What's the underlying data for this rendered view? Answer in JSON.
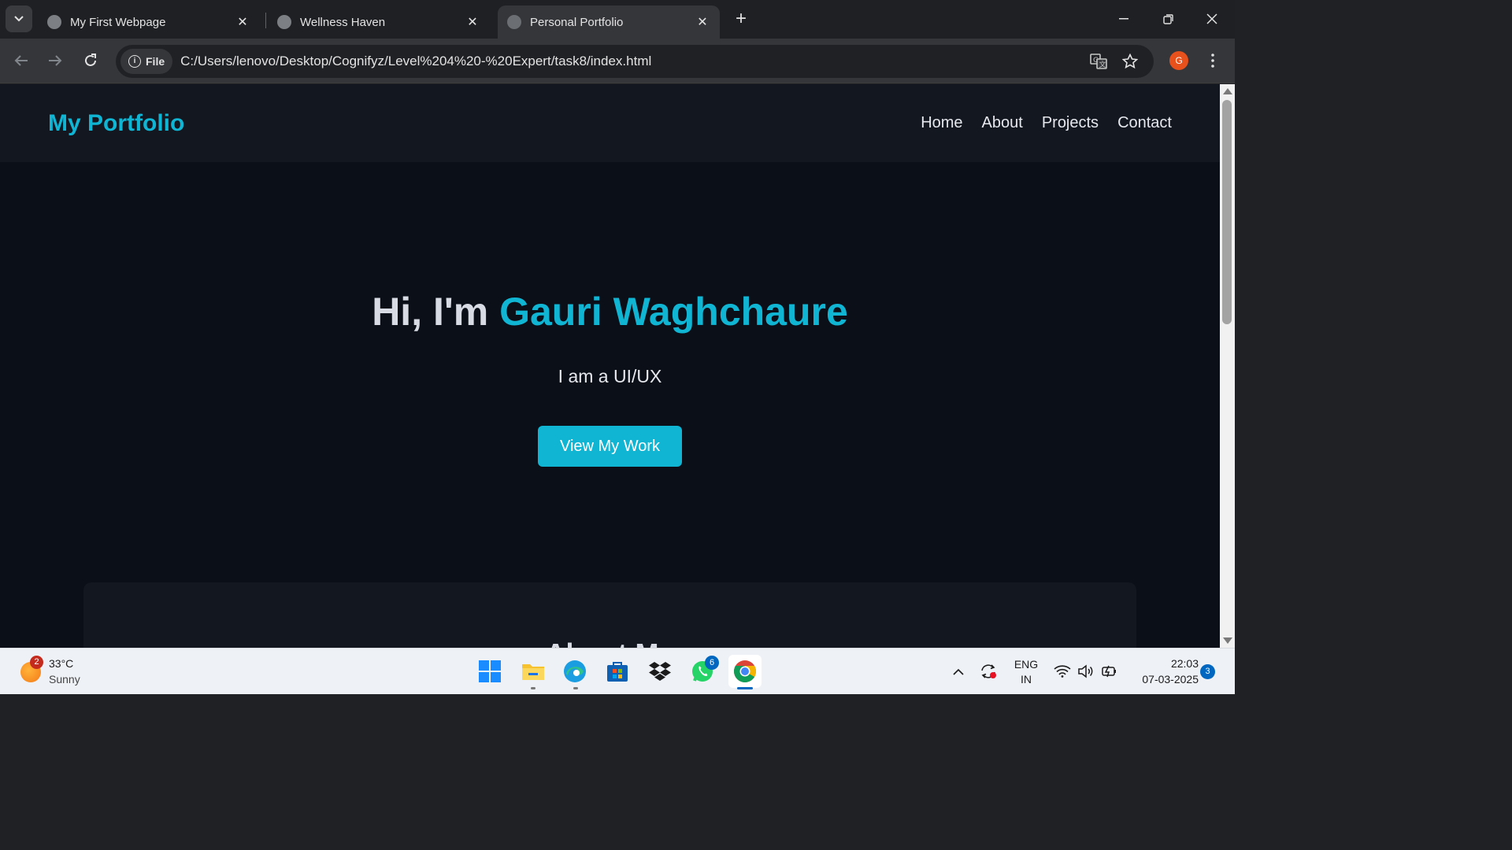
{
  "browser": {
    "tabs": [
      {
        "title": "My First Webpage",
        "active": false
      },
      {
        "title": "Wellness Haven",
        "active": false
      },
      {
        "title": "Personal Portfolio",
        "active": true
      }
    ],
    "chip_label": "File",
    "url": "C:/Users/lenovo/Desktop/Cognifyz/Level%204%20-%20Expert/task8/index.html",
    "profile_initial": "G"
  },
  "site": {
    "brand": "My Portfolio",
    "nav": [
      "Home",
      "About",
      "Projects",
      "Contact"
    ],
    "hero_prefix": "Hi, I'm ",
    "hero_name": "Gauri Waghchaure",
    "hero_subtitle": "I am a UI/UX",
    "cta_label": "View My Work",
    "about_title": "About Me"
  },
  "taskbar": {
    "weather_badge": "2",
    "temperature": "33°C",
    "condition": "Sunny",
    "whatsapp_badge": "6",
    "lang_line1": "ENG",
    "lang_line2": "IN",
    "time": "22:03",
    "date": "07-03-2025",
    "notification_count": "3"
  },
  "colors": {
    "accent": "#10b5d4",
    "page_bg": "#0b0f17",
    "header_bg": "#121720"
  }
}
